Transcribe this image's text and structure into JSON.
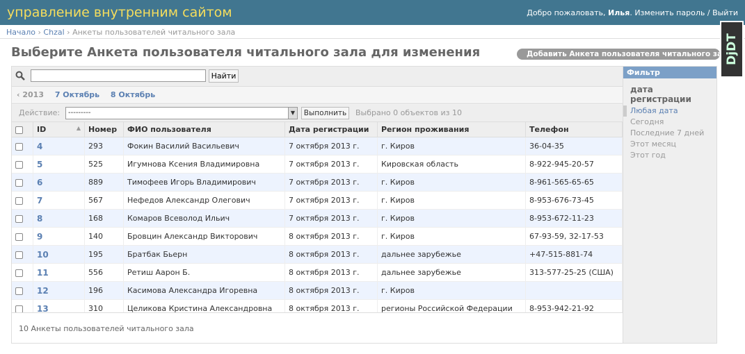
{
  "header": {
    "branding": "управление внутренним сайтом",
    "welcome": "Добро пожаловать,",
    "user": "Илья",
    "separator_period": ".",
    "change_password": "Изменить пароль",
    "slash": "/",
    "logout": "Выйти"
  },
  "breadcrumbs": {
    "home": "Начало",
    "app": "Chzal",
    "current": "Анкеты пользователей читального зала"
  },
  "page": {
    "title": "Выберите Анкета пользователя читального зала для изменения",
    "add_button": "Добавить Анкета пользователя читального зала",
    "add_icon": "plus-icon"
  },
  "djdt": {
    "label": "DjDT"
  },
  "search": {
    "value": "",
    "button": "Найти",
    "icon": "search-icon"
  },
  "date_hierarchy": {
    "prev": "‹ 2013",
    "items": [
      "7 Октябрь",
      "8 Октябрь"
    ]
  },
  "actions": {
    "label": "Действие:",
    "selected": "---------",
    "go": "Выполнить",
    "counter": "Выбрано 0 объектов из 10"
  },
  "table": {
    "columns": [
      "ID",
      "Номер",
      "ФИО пользователя",
      "Дата регистрации",
      "Регион проживания",
      "Телефон"
    ],
    "rows": [
      {
        "id": "4",
        "num": "293",
        "fio": "Фокин Василий Васильевич",
        "date": "7 октября 2013 г.",
        "region": "г. Киров",
        "phone": "36-04-35"
      },
      {
        "id": "5",
        "num": "525",
        "fio": "Игумнова Ксения Владимировна",
        "date": "7 октября 2013 г.",
        "region": "Кировская область",
        "phone": "8-922-945-20-57"
      },
      {
        "id": "6",
        "num": "889",
        "fio": "Тимофеев Игорь Владимирович",
        "date": "7 октября 2013 г.",
        "region": "г. Киров",
        "phone": "8-961-565-65-65"
      },
      {
        "id": "7",
        "num": "567",
        "fio": "Нефедов Александр Олегович",
        "date": "7 октября 2013 г.",
        "region": "г. Киров",
        "phone": "8-953-676-73-45"
      },
      {
        "id": "8",
        "num": "168",
        "fio": "Комаров Всеволод Ильич",
        "date": "7 октября 2013 г.",
        "region": "г. Киров",
        "phone": "8-953-672-11-23"
      },
      {
        "id": "9",
        "num": "140",
        "fio": "Бровцин Александр Викторович",
        "date": "8 октября 2013 г.",
        "region": "г. Киров",
        "phone": "67-93-59, 32-17-53"
      },
      {
        "id": "10",
        "num": "195",
        "fio": "Братбак Бьерн",
        "date": "8 октября 2013 г.",
        "region": "дальнее зарубежье",
        "phone": "+47-515-881-74"
      },
      {
        "id": "11",
        "num": "556",
        "fio": "Ретиш Аарон Б.",
        "date": "8 октября 2013 г.",
        "region": "дальнее зарубежье",
        "phone": "313-577-25-25 (США)"
      },
      {
        "id": "12",
        "num": "196",
        "fio": "Касимова Александра Игоревна",
        "date": "8 октября 2013 г.",
        "region": "г. Киров",
        "phone": ""
      },
      {
        "id": "13",
        "num": "310",
        "fio": "Целикова Кристина Александровна",
        "date": "8 октября 2013 г.",
        "region": "регионы Российской Федерации",
        "phone": "8-953-942-21-92"
      }
    ]
  },
  "paginator": "10 Анкеты пользователей читального зала",
  "filter": {
    "title": "Фильтр",
    "heading": "дата регистрации",
    "items": [
      "Любая дата",
      "Сегодня",
      "Последние 7 дней",
      "Этот месяц",
      "Этот год"
    ],
    "selected_index": 0
  }
}
